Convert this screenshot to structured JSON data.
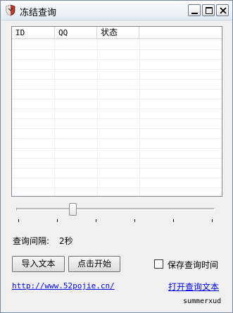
{
  "window": {
    "title": "冻结查询"
  },
  "listview": {
    "columns": [
      "ID",
      "QQ",
      "状态",
      ""
    ],
    "rows": []
  },
  "slider": {
    "value_fraction": 0.28,
    "tick_count": 6
  },
  "interval": {
    "label": "查询间隔:",
    "value": "2秒"
  },
  "buttons": {
    "import_label": "导入文本",
    "start_label": "点击开始"
  },
  "options": {
    "save_time_label": "保存查询时间",
    "save_time_checked": false
  },
  "links": {
    "site": "http://www.52pojie.cn/",
    "open_text": "打开查询文本"
  },
  "footer": {
    "author": "summerxud"
  },
  "colors": {
    "link": "#0000ee",
    "background": "#f0f0f0"
  }
}
